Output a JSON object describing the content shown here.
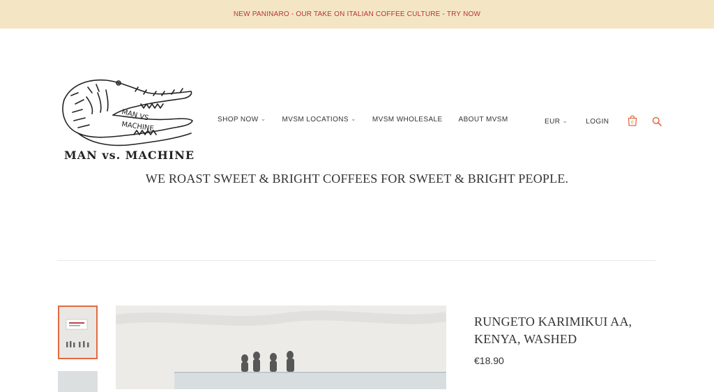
{
  "announcement": {
    "text": "NEW PANINARO - OUR TAKE ON ITALIAN COFFEE CULTURE - TRY NOW"
  },
  "brand": {
    "name": "MAN vs. MACHINE",
    "logo_text_top": "MAN VS",
    "logo_text_bottom": "MACHINE"
  },
  "nav": {
    "items": [
      {
        "label": "SHOP NOW",
        "has_dropdown": true
      },
      {
        "label": "MVSM LOCATIONS",
        "has_dropdown": true
      },
      {
        "label": "MVSM WHOLESALE",
        "has_dropdown": false
      },
      {
        "label": "ABOUT MVSM",
        "has_dropdown": false
      }
    ]
  },
  "utility": {
    "currency": "EUR",
    "login": "LOGIN",
    "cart_count": "0",
    "cart_icon": "shopping-bag-icon",
    "search_icon": "search-icon",
    "accent_color": "#e26a3f"
  },
  "hero": {
    "tagline": "WE ROAST SWEET & BRIGHT COFFEES FOR SWEET & BRIGHT PEOPLE."
  },
  "product": {
    "title_line1": "RUNGETO KARIMIKUI AA,",
    "title_line2": "KENYA, WASHED",
    "price": "€18.90"
  },
  "colors": {
    "announcement_bg": "#f4e6c4",
    "announcement_text": "#b5353a"
  }
}
